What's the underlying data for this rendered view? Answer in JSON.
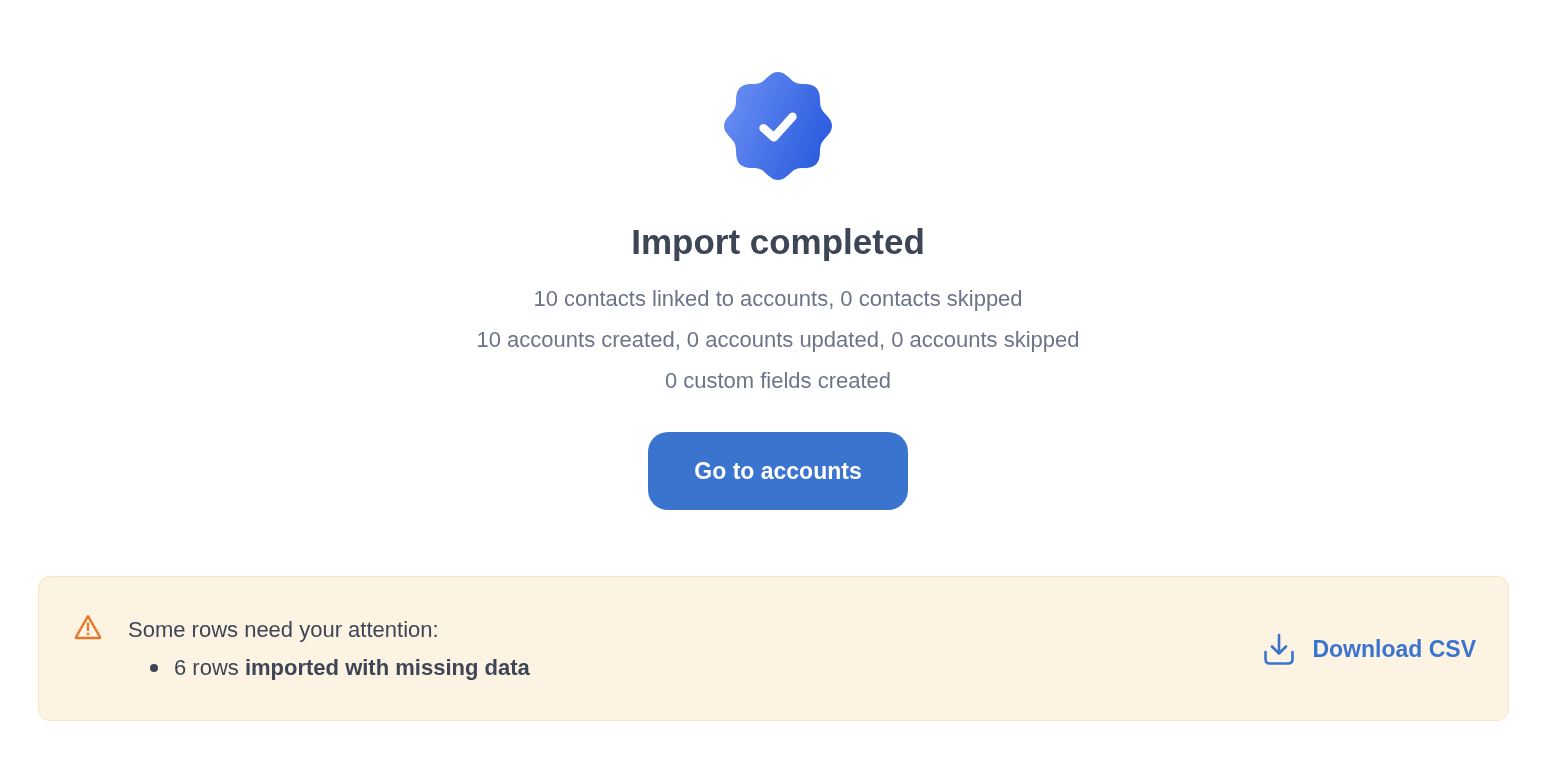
{
  "status": {
    "title": "Import completed"
  },
  "summary": [
    "10 contacts linked to accounts, 0 contacts skipped",
    "10 accounts created, 0 accounts updated, 0 accounts skipped",
    "0 custom fields created"
  ],
  "primary_button": {
    "label": "Go to accounts"
  },
  "notice": {
    "message": "Some rows need your attention:",
    "items": [
      "6 rows **imported with missing data**"
    ],
    "action": {
      "label": "Download CSV"
    }
  }
}
